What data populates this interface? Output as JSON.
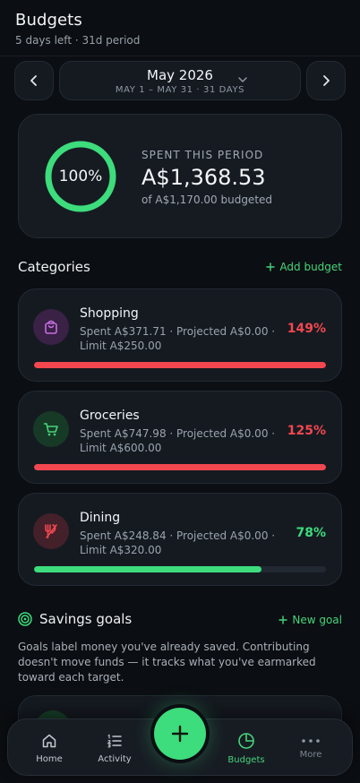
{
  "header": {
    "title": "Budgets",
    "subtitle": "5 days left · 31d period"
  },
  "period": {
    "month": "May 2026",
    "range": "MAY 1 – MAY 31 · 31 DAYS"
  },
  "summary": {
    "ring_label": "100%",
    "ring_progress": 1.0,
    "label": "SPENT THIS PERIOD",
    "amount": "A$1,368.53",
    "budgeted": "of A$1,170.00 budgeted"
  },
  "categories": {
    "title": "Categories",
    "add_label": "Add budget",
    "items": [
      {
        "name": "Shopping",
        "detail": "Spent A$371.71 · Projected A$0.00 · Limit A$250.00",
        "percent": "149%",
        "progress": 1.0,
        "color": "#f2474f",
        "icon": "shopping-bag-icon",
        "icon_bg": "#3a2146",
        "icon_color": "#c46ee0"
      },
      {
        "name": "Groceries",
        "detail": "Spent A$747.98 · Projected A$0.00 · Limit A$600.00",
        "percent": "125%",
        "progress": 1.0,
        "color": "#f2474f",
        "icon": "cart-icon",
        "icon_bg": "#173a27",
        "icon_color": "#47d47a"
      },
      {
        "name": "Dining",
        "detail": "Spent A$248.84 · Projected A$0.00 · Limit A$320.00",
        "percent": "78%",
        "progress": 0.78,
        "color": "#3ddc7c",
        "icon": "utensils-icon",
        "icon_bg": "#43202a",
        "icon_color": "#f2474f"
      }
    ]
  },
  "goals": {
    "title": "Savings goals",
    "add_label": "New goal",
    "description": "Goals label money you've already saved. Contributing doesn't move funds — it tracks what you've earmarked toward each target."
  },
  "tabbar": {
    "home": "Home",
    "activity": "Activity",
    "budgets": "Budgets",
    "more": "More"
  },
  "colors": {
    "accent": "#3ddc7c",
    "over": "#f2474f",
    "background": "#0b0e12"
  }
}
